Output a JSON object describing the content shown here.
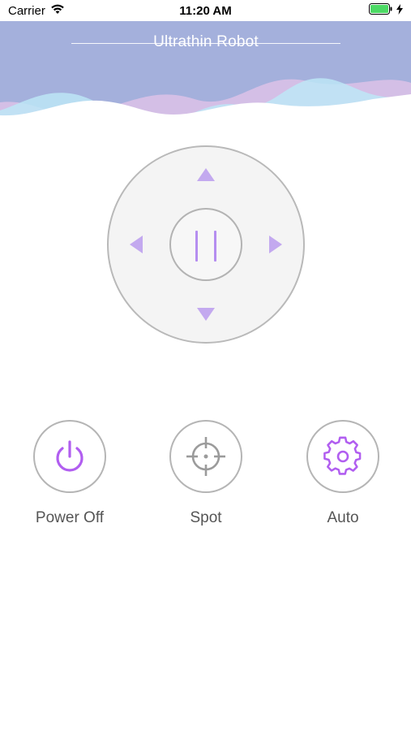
{
  "status_bar": {
    "carrier": "Carrier",
    "time": "11:20 AM"
  },
  "header": {
    "title": "Ultrathin Robot"
  },
  "dpad": {
    "up": "arrow-up",
    "down": "arrow-down",
    "left": "arrow-left",
    "right": "arrow-right",
    "center": "pause"
  },
  "actions": [
    {
      "label": "Power Off",
      "icon": "power-icon"
    },
    {
      "label": "Spot",
      "icon": "crosshair-icon"
    },
    {
      "label": "Auto",
      "icon": "gear-icon"
    }
  ],
  "colors": {
    "header_bg": "#a4b0dc",
    "accent": "#b58ef0",
    "wave_blue": "#bde6f6",
    "wave_purple": "#d7c0e6",
    "battery": "#4cd964"
  }
}
